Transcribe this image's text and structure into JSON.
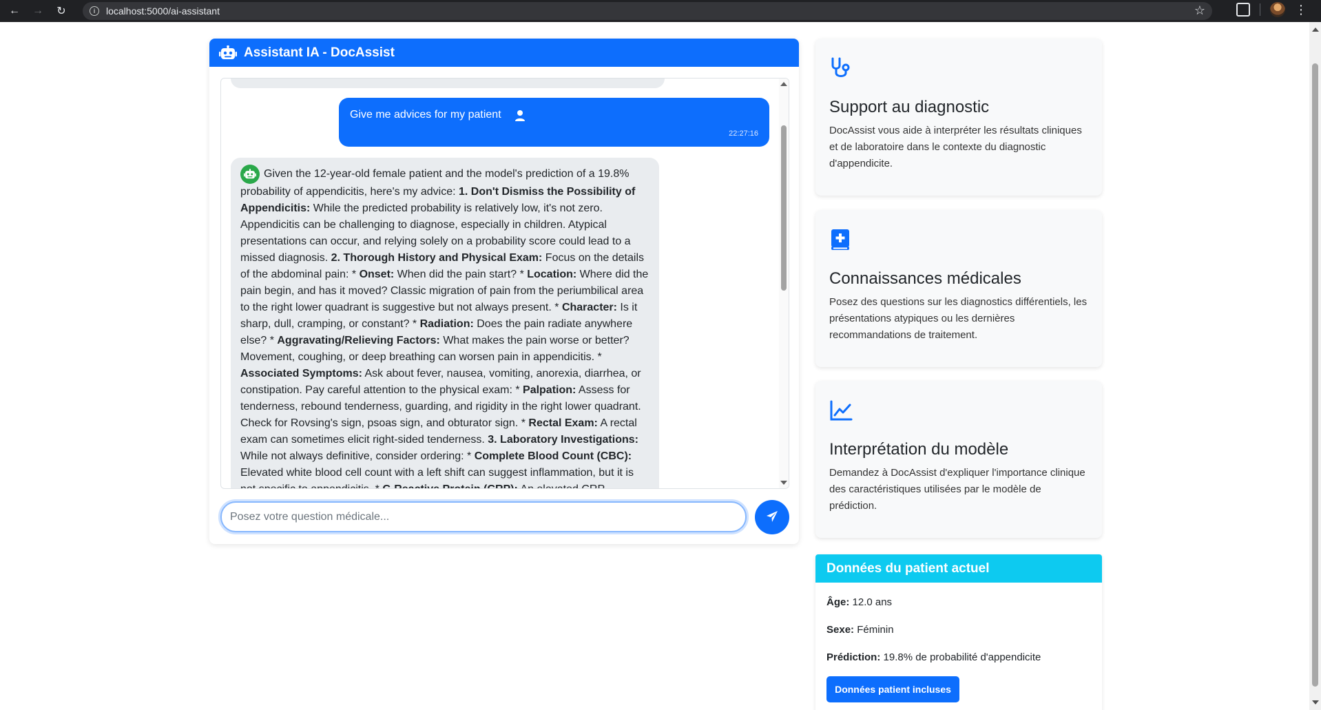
{
  "browser": {
    "url": "localhost:5000/ai-assistant",
    "back_icon": "arrow-left-icon",
    "forward_icon": "arrow-right-icon",
    "reload_icon": "reload-icon",
    "star_icon": "star-icon",
    "extensions_icon": "puzzle-icon"
  },
  "chat": {
    "title": "Assistant IA - DocAssist",
    "user_message": {
      "text": "Give me advices for my patient",
      "time": "22:27:16"
    },
    "bot_message": {
      "segments": [
        {
          "t": "Given the 12-year-old female patient and the model's prediction of a 19.8% probability of appendicitis, here's my advice: ",
          "b": false
        },
        {
          "t": "1. Don't Dismiss the Possibility of Appendicitis:",
          "b": true
        },
        {
          "t": " While the predicted probability is relatively low, it's not zero. Appendicitis can be challenging to diagnose, especially in children. Atypical presentations can occur, and relying solely on a probability score could lead to a missed diagnosis. ",
          "b": false
        },
        {
          "t": "2. Thorough History and Physical Exam:",
          "b": true
        },
        {
          "t": " Focus on the details of the abdominal pain: * ",
          "b": false
        },
        {
          "t": "Onset:",
          "b": true
        },
        {
          "t": " When did the pain start? * ",
          "b": false
        },
        {
          "t": "Location:",
          "b": true
        },
        {
          "t": " Where did the pain begin, and has it moved? Classic migration of pain from the periumbilical area to the right lower quadrant is suggestive but not always present. * ",
          "b": false
        },
        {
          "t": "Character:",
          "b": true
        },
        {
          "t": " Is it sharp, dull, cramping, or constant? * ",
          "b": false
        },
        {
          "t": "Radiation:",
          "b": true
        },
        {
          "t": " Does the pain radiate anywhere else? * ",
          "b": false
        },
        {
          "t": "Aggravating/Relieving Factors:",
          "b": true
        },
        {
          "t": " What makes the pain worse or better? Movement, coughing, or deep breathing can worsen pain in appendicitis. * ",
          "b": false
        },
        {
          "t": "Associated Symptoms:",
          "b": true
        },
        {
          "t": " Ask about fever, nausea, vomiting, anorexia, diarrhea, or constipation. Pay careful attention to the physical exam: * ",
          "b": false
        },
        {
          "t": "Palpation:",
          "b": true
        },
        {
          "t": " Assess for tenderness, rebound tenderness, guarding, and rigidity in the right lower quadrant. Check for Rovsing's sign, psoas sign, and obturator sign. * ",
          "b": false
        },
        {
          "t": "Rectal Exam:",
          "b": true
        },
        {
          "t": " A rectal exam can sometimes elicit right-sided tenderness. ",
          "b": false
        },
        {
          "t": "3. Laboratory Investigations:",
          "b": true
        },
        {
          "t": " While not always definitive, consider ordering: * ",
          "b": false
        },
        {
          "t": "Complete Blood Count (CBC):",
          "b": true
        },
        {
          "t": " Elevated white blood cell count with a left shift can suggest inflammation, but it is not specific to appendicitis. * ",
          "b": false
        },
        {
          "t": "C-Reactive Protein (CRP):",
          "b": true
        },
        {
          "t": " An elevated CRP",
          "b": false
        }
      ]
    },
    "input": {
      "placeholder": "Posez votre question médicale...",
      "value": ""
    },
    "send_icon": "paper-plane-icon"
  },
  "features": [
    {
      "icon": "stethoscope-icon",
      "title": "Support au diagnostic",
      "text": "DocAssist vous aide à interpréter les résultats cliniques et de laboratoire dans le contexte du diagnostic d'appendicite."
    },
    {
      "icon": "medical-book-icon",
      "title": "Connaissances médicales",
      "text": "Posez des questions sur les diagnostics différentiels, les présentations atypiques ou les dernières recommandations de traitement."
    },
    {
      "icon": "chart-line-icon",
      "title": "Interprétation du modèle",
      "text": "Demandez à DocAssist d'expliquer l'importance clinique des caractéristiques utilisées par le modèle de prédiction."
    }
  ],
  "patient": {
    "title": "Données du patient actuel",
    "age_label": "Âge:",
    "age_value": "12.0 ans",
    "sex_label": "Sexe:",
    "sex_value": "Féminin",
    "prediction_label": "Prédiction:",
    "prediction_value": "19.8% de probabilité d'appendicite",
    "button_label": "Données patient incluses"
  },
  "colors": {
    "primary": "#0d6efd",
    "info": "#0dcaf0",
    "bot_avatar": "#2aa84a"
  }
}
